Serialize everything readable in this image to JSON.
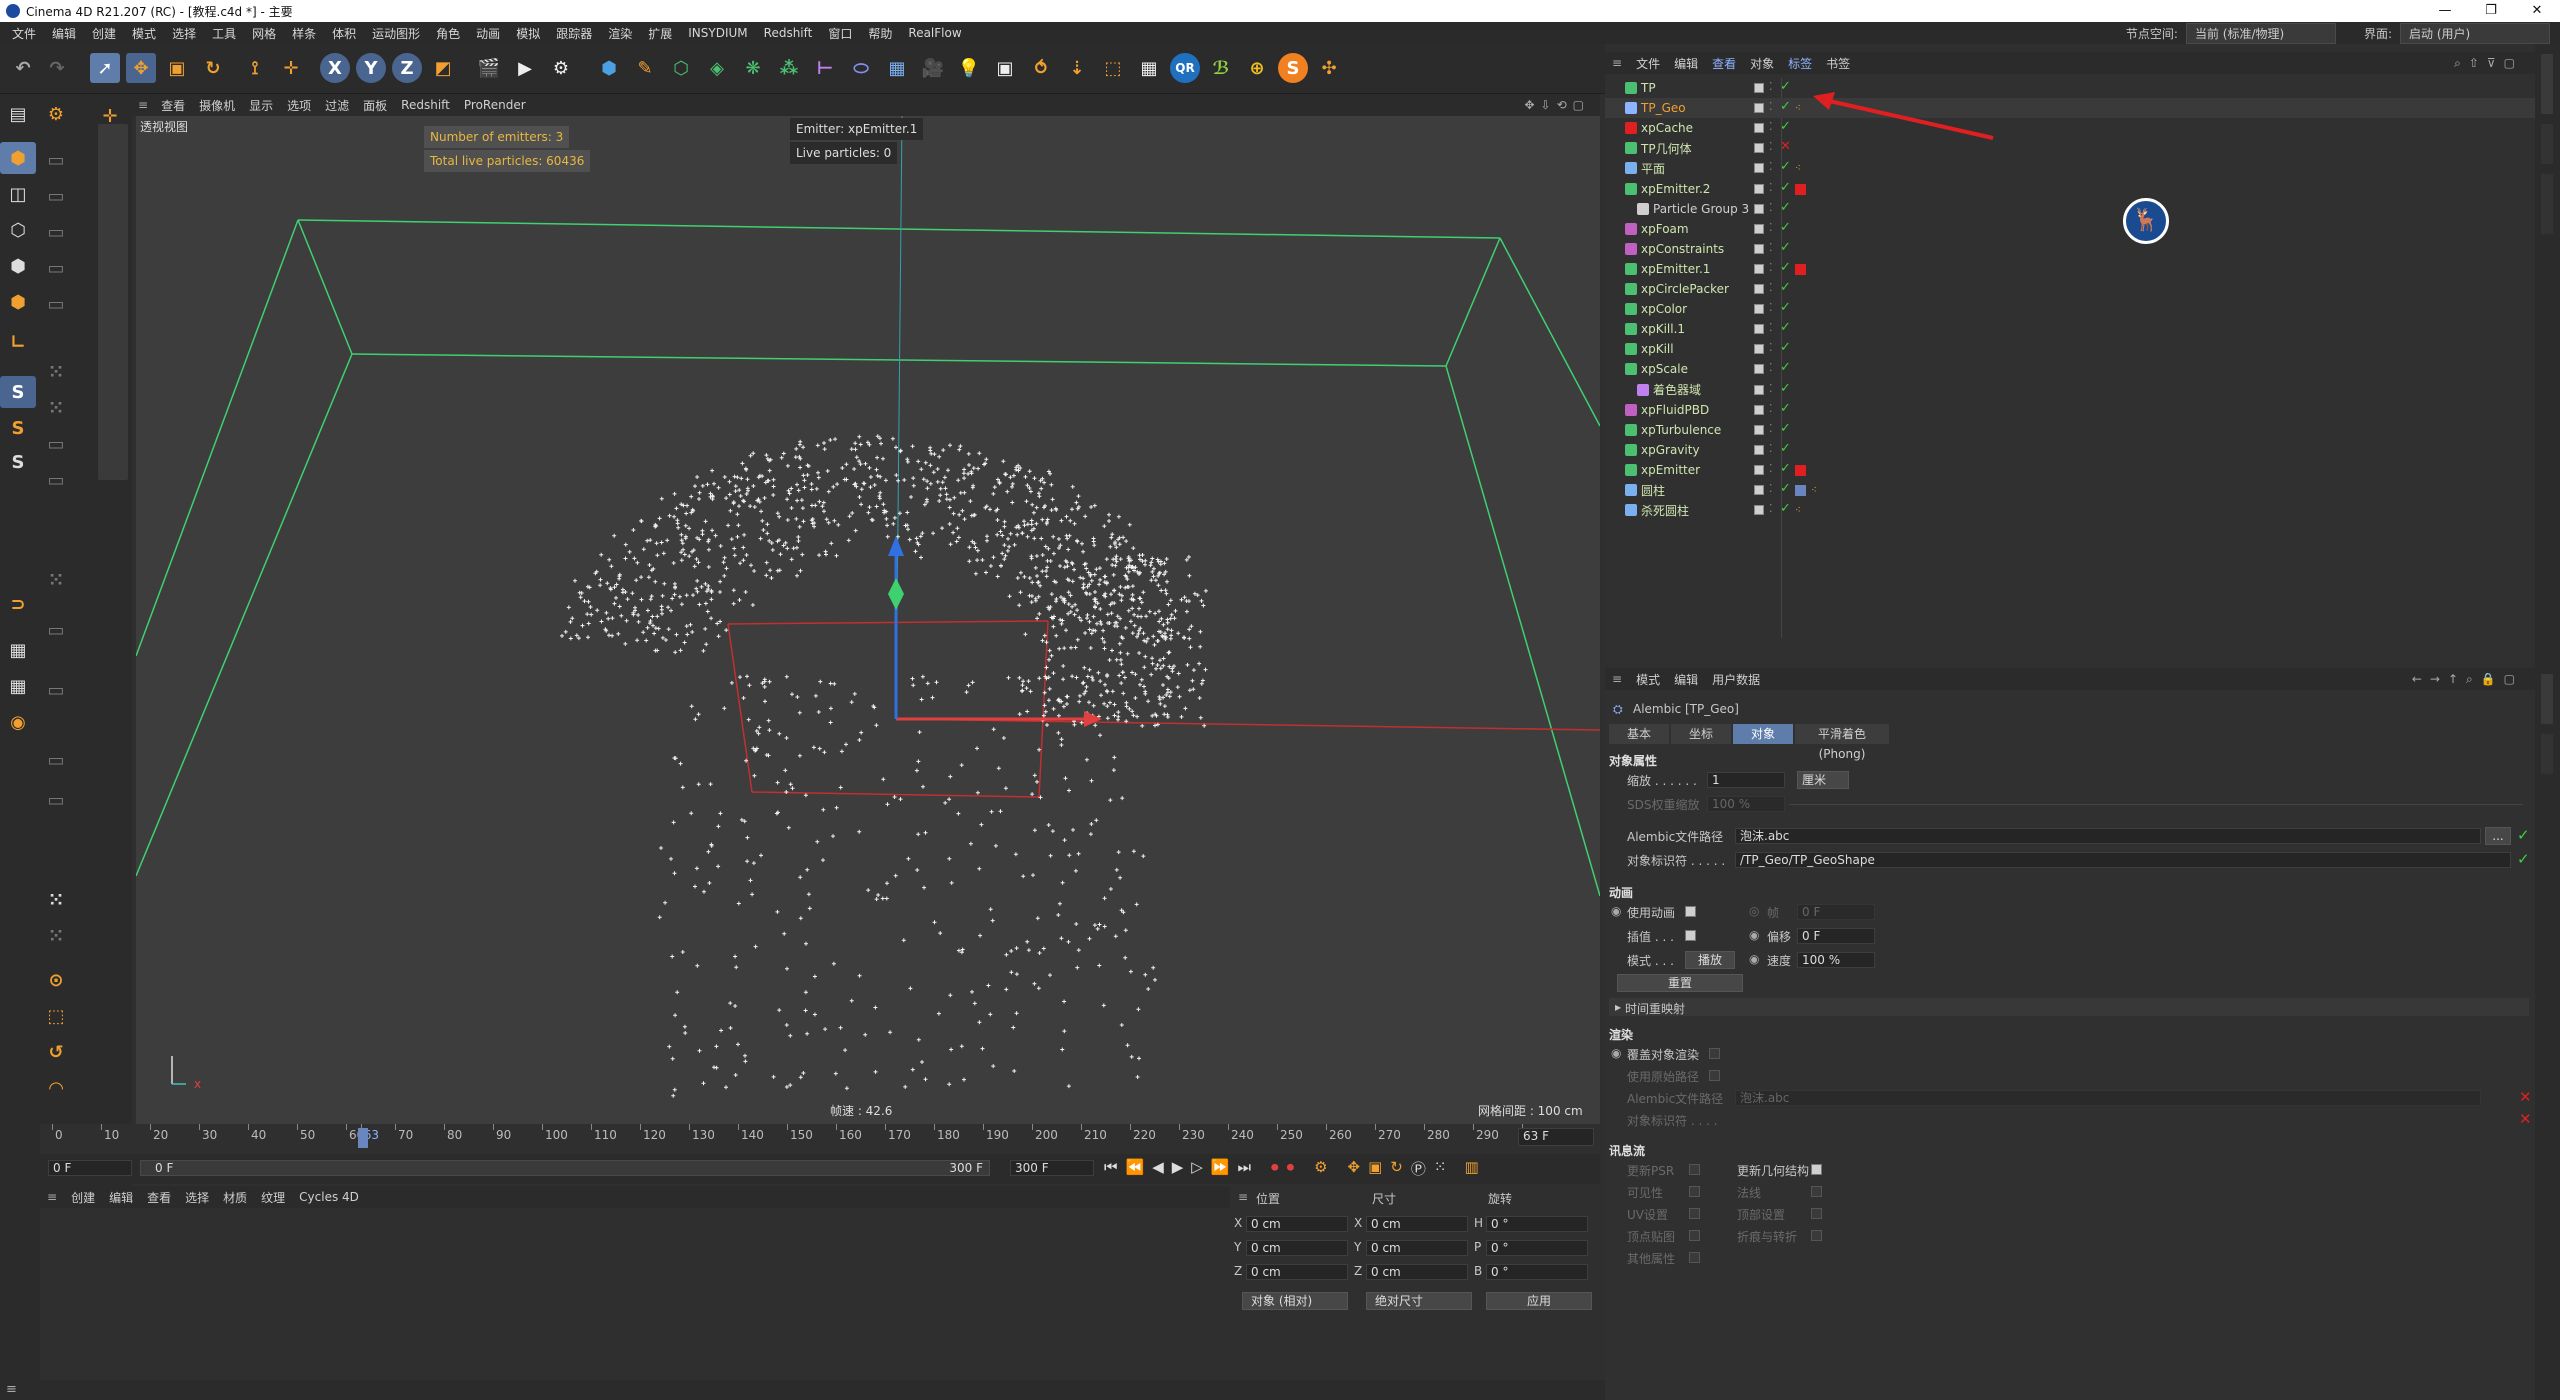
{
  "window": {
    "title": "Cinema 4D R21.207 (RC) - [教程.c4d *] - 主要",
    "buttons": [
      "—",
      "❐",
      "✕"
    ]
  },
  "menubar": {
    "items": [
      "文件",
      "编辑",
      "创建",
      "模式",
      "选择",
      "工具",
      "网格",
      "样条",
      "体积",
      "运动图形",
      "角色",
      "动画",
      "模拟",
      "跟踪器",
      "渲染",
      "扩展",
      "INSYDIUM",
      "Redshift",
      "窗口",
      "帮助",
      "RealFlow"
    ],
    "node_space_label": "节点空间:",
    "node_space_value": "当前 (标准/物理)",
    "layout_label": "界面:",
    "layout_value": "启动 (用户)"
  },
  "viewport": {
    "menu": [
      "查看",
      "摄像机",
      "显示",
      "选项",
      "过滤",
      "面板",
      "Redshift",
      "ProRender"
    ],
    "name": "透视视图",
    "hud_emitters": "Number of emitters: 3",
    "hud_particles": "Total live particles: 60436",
    "hud_emitter_name": "Emitter: xpEmitter.1",
    "hud_live": "Live particles: 0",
    "fps": "帧速 : 42.6",
    "grid": "网格间距 : 100 cm"
  },
  "timeline": {
    "ticks": [
      "0",
      "10",
      "20",
      "30",
      "40",
      "50",
      "60",
      "63",
      "70",
      "80",
      "90",
      "100",
      "110",
      "120",
      "130",
      "140",
      "150",
      "160",
      "170",
      "180",
      "190",
      "200",
      "210",
      "220",
      "230",
      "240",
      "250",
      "260",
      "270",
      "280",
      "290",
      "300"
    ],
    "current_frame": "63 F",
    "start": "0 F",
    "range_start": "0 F",
    "range_end": "300 F",
    "end": "300 F"
  },
  "material_panel": {
    "menu": [
      "创建",
      "编辑",
      "查看",
      "选择",
      "材质",
      "纹理",
      "Cycles 4D"
    ]
  },
  "coords": {
    "headers": [
      "位置",
      "尺寸",
      "旋转"
    ],
    "rows": [
      {
        "axis": "X",
        "pos": "0 cm",
        "size_axis": "X",
        "size": "0 cm",
        "rot_axis": "H",
        "rot": "0 °"
      },
      {
        "axis": "Y",
        "pos": "0 cm",
        "size_axis": "Y",
        "size": "0 cm",
        "rot_axis": "P",
        "rot": "0 °"
      },
      {
        "axis": "Z",
        "pos": "0 cm",
        "size_axis": "Z",
        "size": "0 cm",
        "rot_axis": "B",
        "rot": "0 °"
      }
    ],
    "mode1": "对象 (相对)",
    "mode2": "绝对尺寸",
    "apply": "应用"
  },
  "object_manager": {
    "menu": [
      "文件",
      "编辑",
      "查看",
      "对象",
      "标签",
      "书签"
    ],
    "objects": [
      {
        "name": "TP",
        "color": "#cfe6b0"
      },
      {
        "name": "TP_Geo",
        "color": "#f0a030"
      },
      {
        "name": "xpCache",
        "color": "#cfe6b0"
      },
      {
        "name": "TP几何体",
        "color": "#cfe6b0"
      },
      {
        "name": "平面",
        "color": "#cfe6b0"
      },
      {
        "name": "xpEmitter.2",
        "color": "#cfe6b0"
      },
      {
        "name": "Particle Group 3",
        "color": "#cfcfcf"
      },
      {
        "name": "xpFoam",
        "color": "#cfe6b0"
      },
      {
        "name": "xpConstraints",
        "color": "#cfe6b0"
      },
      {
        "name": "xpEmitter.1",
        "color": "#cfe6b0"
      },
      {
        "name": "xpCirclePacker",
        "color": "#cfe6b0"
      },
      {
        "name": "xpColor",
        "color": "#cfe6b0"
      },
      {
        "name": "xpKill.1",
        "color": "#cfe6b0"
      },
      {
        "name": "xpKill",
        "color": "#cfe6b0"
      },
      {
        "name": "xpScale",
        "color": "#cfe6b0"
      },
      {
        "name": "着色器域",
        "color": "#cfe6b0"
      },
      {
        "name": "xpFluidPBD",
        "color": "#cfe6b0"
      },
      {
        "name": "xpTurbulence",
        "color": "#cfe6b0"
      },
      {
        "name": "xpGravity",
        "color": "#cfe6b0"
      },
      {
        "name": "xpEmitter",
        "color": "#cfe6b0"
      },
      {
        "name": "圆柱",
        "color": "#cfe6b0"
      },
      {
        "name": "杀死圆柱",
        "color": "#cfe6b0"
      }
    ]
  },
  "attributes": {
    "menu": [
      "模式",
      "编辑",
      "用户数据"
    ],
    "object_title": "Alembic [TP_Geo]",
    "tabs": [
      "基本",
      "坐标",
      "对象",
      "平滑着色(Phong)"
    ],
    "section_object": "对象属性",
    "scale_label": "缩放 . . . . . .",
    "scale_value": "1",
    "scale_unit": "厘米",
    "sds_label": "SDS权重缩放",
    "sds_value": "100 %",
    "path_label": "Alembic文件路径",
    "path_value": "泡沫.abc",
    "path_btn": "...",
    "id_label": "对象标识符 . . . . .",
    "id_value": "/TP_Geo/TP_GeoShape",
    "section_anim": "动画",
    "use_anim": "使用动画",
    "frame_label": "帧",
    "frame_value": "0 F",
    "interp_label": "插值 . . .",
    "offset_label": "偏移",
    "offset_value": "0 F",
    "mode_label": "模式 . . .",
    "mode_value": "播放",
    "speed_label": "速度",
    "speed_value": "100 %",
    "reset": "重置",
    "remap": "时间重映射",
    "section_render": "渲染",
    "override_render": "覆盖对象渲染",
    "use_orig_path": "使用原始路径",
    "r_path_label": "Alembic文件路径",
    "r_path_value": "泡沫.abc",
    "r_id_label": "对象标识符 . . . .",
    "section_stream": "讯息流",
    "stream_left": [
      "更新PSR",
      "可见性",
      "UV设置",
      "顶点贴图",
      "其他属性"
    ],
    "stream_right": [
      "更新几何结构",
      "法线",
      "顶部设置",
      "折痕与转折"
    ]
  }
}
